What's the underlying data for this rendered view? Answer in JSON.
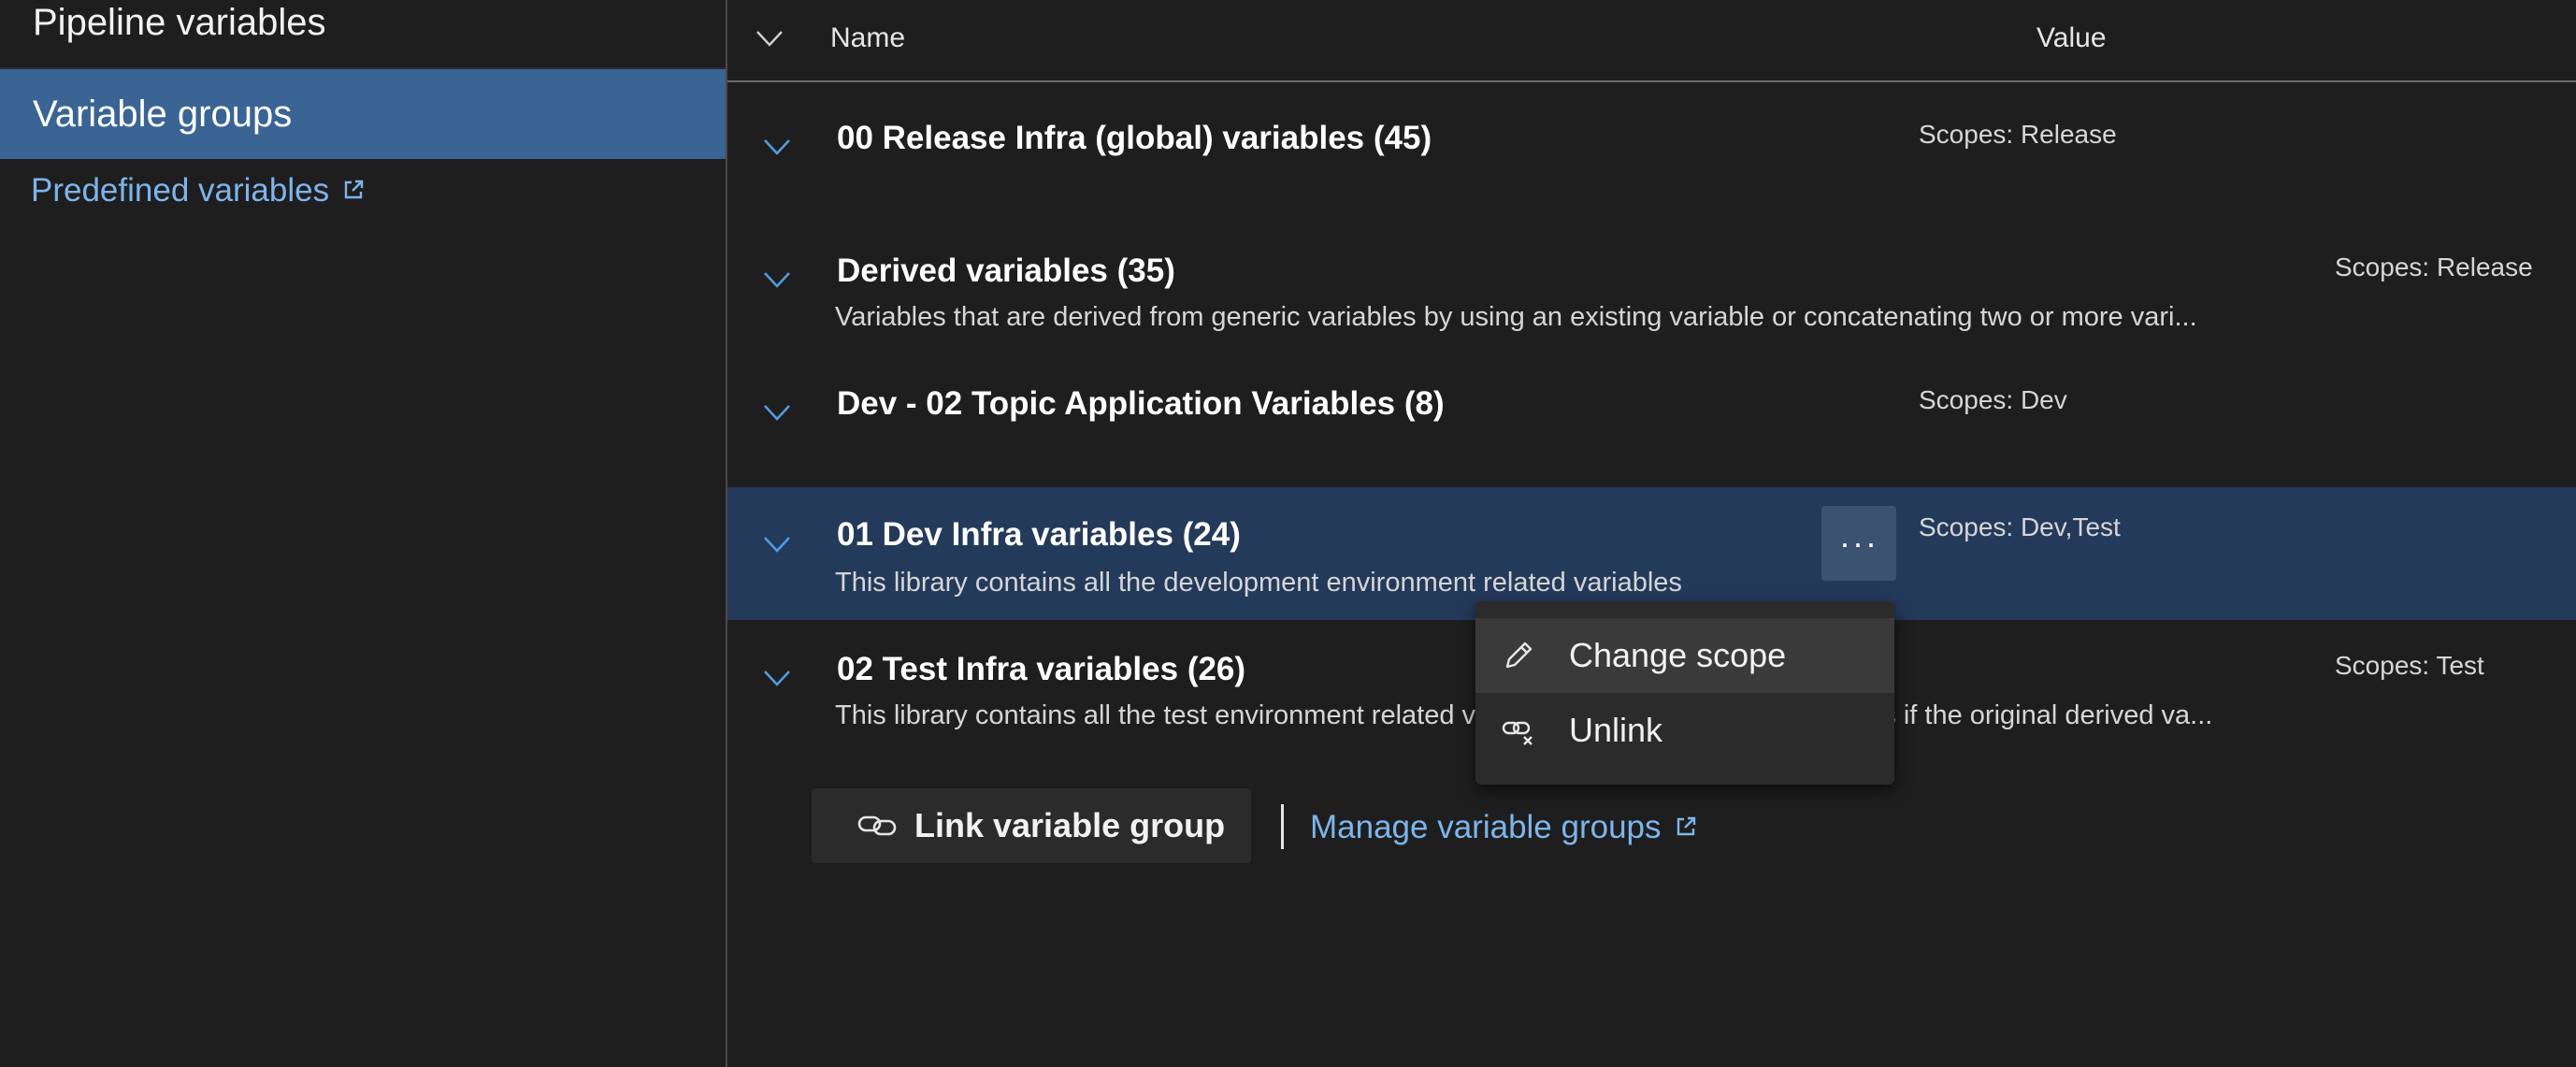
{
  "sidebar": {
    "title": "Pipeline variables",
    "selected_item": "Variable groups",
    "predefined_link": "Predefined variables"
  },
  "table": {
    "header_name": "Name",
    "header_value": "Value",
    "rows": [
      {
        "title": "00 Release Infra (global) variables (45)",
        "description": "",
        "scope": "Scopes: Release"
      },
      {
        "title": "Derived variables (35)",
        "description": "Variables that are derived from generic variables by using an existing variable or concatenating two or more vari...",
        "scope": "Scopes: Release"
      },
      {
        "title": "Dev - 02 Topic Application Variables (8)",
        "description": "",
        "scope": "Scopes: Dev"
      },
      {
        "title": "01 Dev Infra variables (24)",
        "description": "This library contains all the development environment related variables",
        "scope": "Scopes: Dev,Test"
      },
      {
        "title": "02 Test Infra variables (26)",
        "description": "This library contains all the test environment related variables. Please note that it adjusts if the original derived va...",
        "scope": "Scopes: Test"
      }
    ]
  },
  "more_button_label": "···",
  "context_menu": {
    "items": [
      "Change scope",
      "Unlink"
    ]
  },
  "footer": {
    "link_button": "Link variable group",
    "manage_link": "Manage variable groups"
  },
  "colors": {
    "background": "#1f1e1e",
    "selected_sidebar": "#3a6494",
    "selected_row": "#243a5a",
    "link": "#7cb5ec",
    "chevron": "#4f9be0"
  }
}
